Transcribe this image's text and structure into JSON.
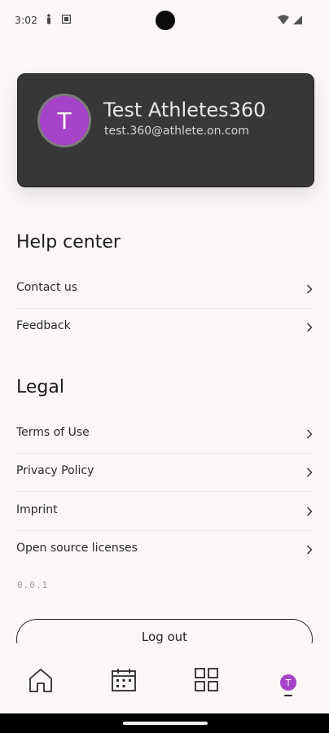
{
  "status_bar": {
    "time": "3:02"
  },
  "profile": {
    "initial": "T",
    "name": "Test Athletes360",
    "email": "test.360@athlete.on.com"
  },
  "help_center": {
    "title": "Help center",
    "items": [
      {
        "label": "Contact us"
      },
      {
        "label": "Feedback"
      }
    ]
  },
  "legal": {
    "title": "Legal",
    "items": [
      {
        "label": "Terms of Use"
      },
      {
        "label": "Privacy Policy"
      },
      {
        "label": "Imprint"
      },
      {
        "label": "Open source licenses"
      }
    ]
  },
  "version": "0.0.1",
  "logout_label": "Log out",
  "bottom_nav": {
    "items": [
      {
        "icon": "home-icon"
      },
      {
        "icon": "calendar-icon"
      },
      {
        "icon": "grid-icon"
      },
      {
        "icon": "profile-avatar",
        "initial": "T",
        "active": true
      }
    ]
  },
  "colors": {
    "accent": "#a743c9",
    "card": "#373737",
    "background": "#faf7f6"
  }
}
